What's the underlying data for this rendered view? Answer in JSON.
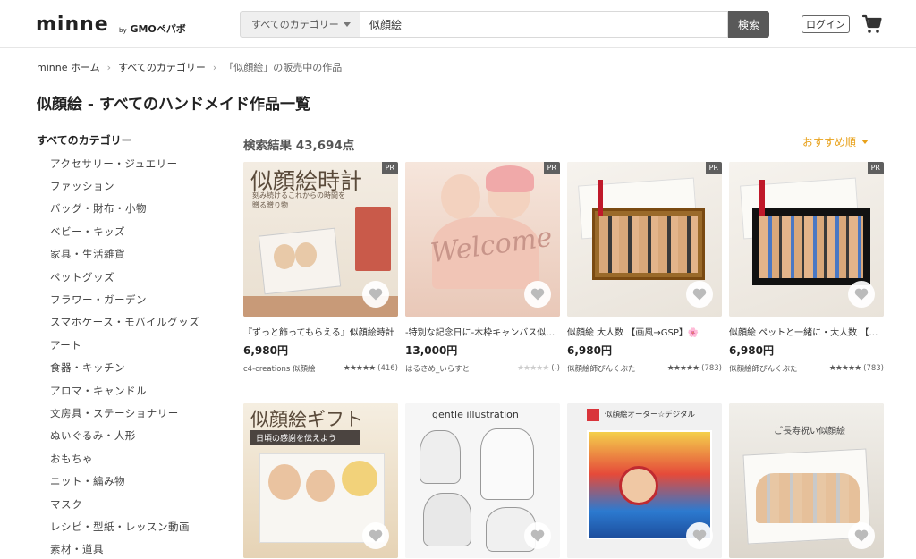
{
  "header": {
    "logo": "minne",
    "logo_by": "by",
    "logo_brand": "GMOペパボ",
    "search_category": "すべてのカテゴリー",
    "search_query": "似顔絵",
    "search_button": "検索",
    "login": "ログイン"
  },
  "breadcrumb": {
    "home": "minne ホーム",
    "category": "すべてのカテゴリー",
    "current": "「似顔絵」の販売中の作品"
  },
  "page_title": "似顔絵 - すべてのハンドメイド作品一覧",
  "sidebar": {
    "heading": "すべてのカテゴリー",
    "items": [
      {
        "label": "アクセサリー・ジュエリー"
      },
      {
        "label": "ファッション"
      },
      {
        "label": "バッグ・財布・小物"
      },
      {
        "label": "ベビー・キッズ"
      },
      {
        "label": "家具・生活雑貨"
      },
      {
        "label": "ペットグッズ"
      },
      {
        "label": "フラワー・ガーデン"
      },
      {
        "label": "スマホケース・モバイルグッズ"
      },
      {
        "label": "アート"
      },
      {
        "label": "食器・キッチン"
      },
      {
        "label": "アロマ・キャンドル"
      },
      {
        "label": "文房具・ステーショナリー"
      },
      {
        "label": "ぬいぐるみ・人形"
      },
      {
        "label": "おもちゃ"
      },
      {
        "label": "ニット・編み物"
      },
      {
        "label": "マスク"
      },
      {
        "label": "レシピ・型紙・レッスン動画"
      },
      {
        "label": "素材・道具"
      }
    ]
  },
  "results": {
    "count_label": "検索結果 43,694点",
    "sort_label": "おすすめ順"
  },
  "products": [
    {
      "title": "『ずっと飾ってもらえる』似顔絵時計",
      "price": "6,980円",
      "seller": "c4-creations 似顔絵",
      "rating": 5,
      "reviews": "(416)",
      "pr": "PR",
      "thumb_text": "似顔絵時計",
      "thumb_sub": "刻み続けるこれからの時間を贈る贈り物"
    },
    {
      "title": "-特別な記念日に-木枠キャンバス似顔絵",
      "price": "13,000円",
      "seller": "はるさめ_いらすと",
      "rating": 0,
      "reviews": "(-)",
      "pr": "PR",
      "thumb_text": "Welcome",
      "thumb_sub": ""
    },
    {
      "title": "似顔絵 大人数 【画風→GSP】🌸",
      "price": "6,980円",
      "seller": "似顔絵師ぴんくぶた",
      "rating": 5,
      "reviews": "(783)",
      "pr": "PR",
      "thumb_text": "",
      "thumb_sub": ""
    },
    {
      "title": "似顔絵 ペットと一緒に・大人数 【画風→GSP】",
      "price": "6,980円",
      "seller": "似顔絵師ぴんくぶた",
      "rating": 5,
      "reviews": "(783)",
      "pr": "PR",
      "thumb_text": "",
      "thumb_sub": ""
    },
    {
      "title": "",
      "price": "",
      "seller": "",
      "rating": 0,
      "reviews": "",
      "pr": "",
      "thumb_text": "似顔絵ギフト",
      "thumb_sub": "日頃の感謝を伝えよう"
    },
    {
      "title": "",
      "price": "",
      "seller": "",
      "rating": 0,
      "reviews": "",
      "pr": "",
      "thumb_text": "gentle illustration",
      "thumb_sub": ""
    },
    {
      "title": "",
      "price": "",
      "seller": "",
      "rating": 0,
      "reviews": "",
      "pr": "",
      "thumb_text": "似顔絵オーダー☆デジタル",
      "thumb_sub": ""
    },
    {
      "title": "",
      "price": "",
      "seller": "",
      "rating": 0,
      "reviews": "",
      "pr": "",
      "thumb_text": "ご長寿祝い似顔絵",
      "thumb_sub": ""
    }
  ],
  "icons": {
    "cart": "cart-icon",
    "favorite": "heart-icon",
    "dropdown": "chevron-down-icon"
  },
  "colors": {
    "accent": "#e8a11a",
    "search_button": "#595959"
  }
}
